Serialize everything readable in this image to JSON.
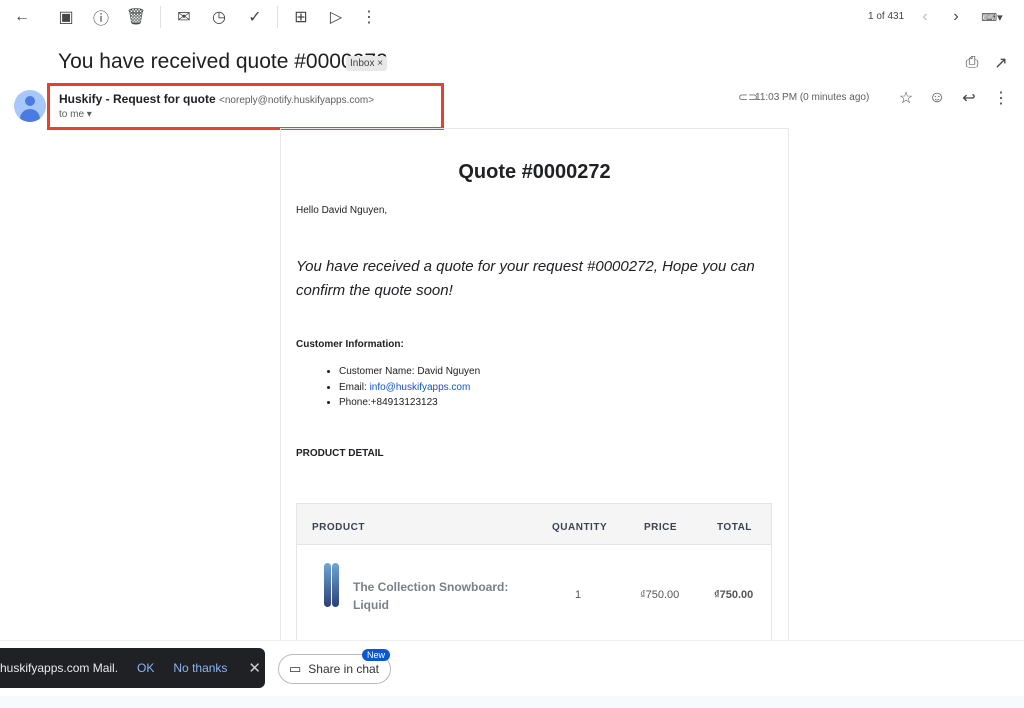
{
  "toolbar": {
    "pagination": "1 of 431",
    "icons": [
      "back",
      "archive",
      "report-spam",
      "delete",
      "mark-unread",
      "snooze",
      "add-to-tasks",
      "move-to",
      "labels",
      "more"
    ]
  },
  "email": {
    "subject": "You have received quote #0000272",
    "label_chip": "Inbox",
    "sender_name": "Huskify - Request for quote",
    "sender_email": "<noreply@notify.huskifyapps.com>",
    "to": "to me",
    "time": "11:03 PM (0 minutes ago)",
    "highlight_color": "#e8402e"
  },
  "body": {
    "title": "Quote #0000272",
    "greeting": "Hello David Nguyen,",
    "message": "You have received a quote for your request #0000272, Hope you can confirm the quote soon!",
    "customer_heading": "Customer Information:",
    "customer_name": "Customer Name: David Nguyen",
    "email_label": "Email: ",
    "email_link": "info@huskifyapps.com",
    "phone": "Phone:+84913123123",
    "product_heading": "PRODUCT DETAIL",
    "table": {
      "headers": [
        "PRODUCT",
        "QUANTITY",
        "PRICE",
        "TOTAL"
      ],
      "rows": [
        {
          "product": "The Collection Snowboard: Liquid",
          "quantity": "1",
          "price": "₫750.00",
          "total": "₫750.00"
        }
      ]
    }
  },
  "snackbar": {
    "text": "huskifyapps.com Mail.",
    "ok": "OK",
    "no_thanks": "No thanks"
  },
  "share": {
    "label": "Share in chat",
    "badge": "New"
  }
}
